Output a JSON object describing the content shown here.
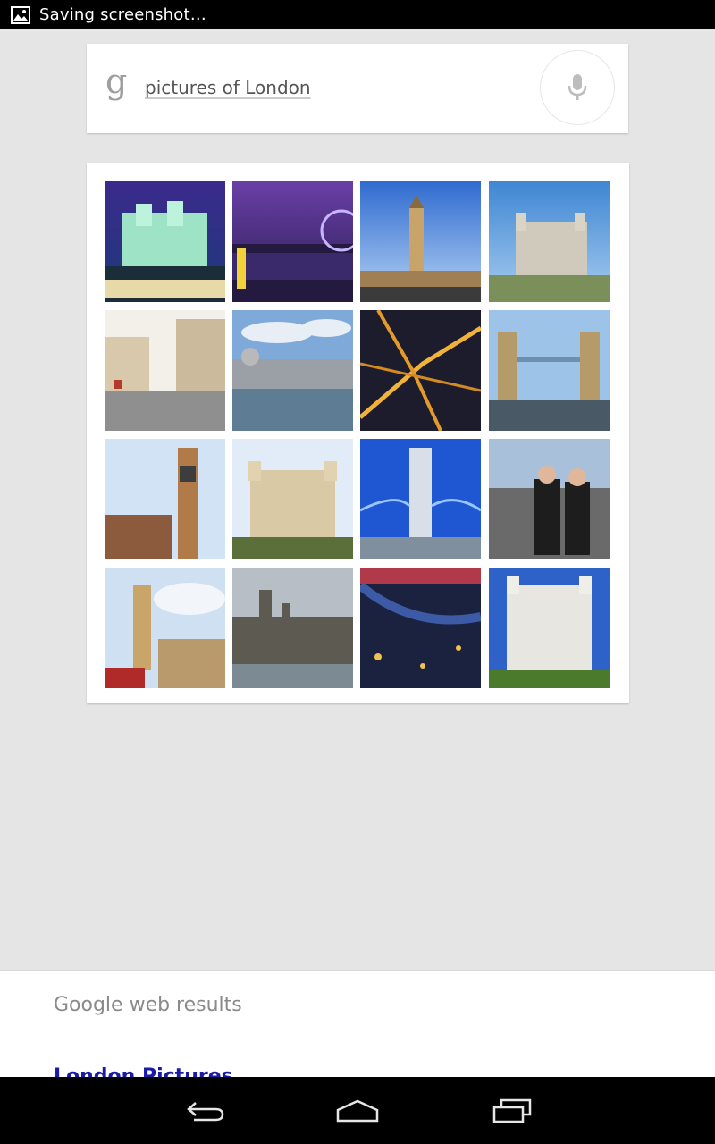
{
  "status_bar": {
    "text": "Saving screenshot…",
    "icon": "image-icon"
  },
  "search": {
    "logo": "g",
    "query": "pictures of London",
    "mic_icon": "microphone-icon"
  },
  "images": {
    "count": 16
  },
  "results": {
    "header": "Google web results",
    "first_link": "London Pictures"
  },
  "nav": {
    "back_icon": "back-icon",
    "home_icon": "home-icon",
    "recents_icon": "recents-icon"
  }
}
